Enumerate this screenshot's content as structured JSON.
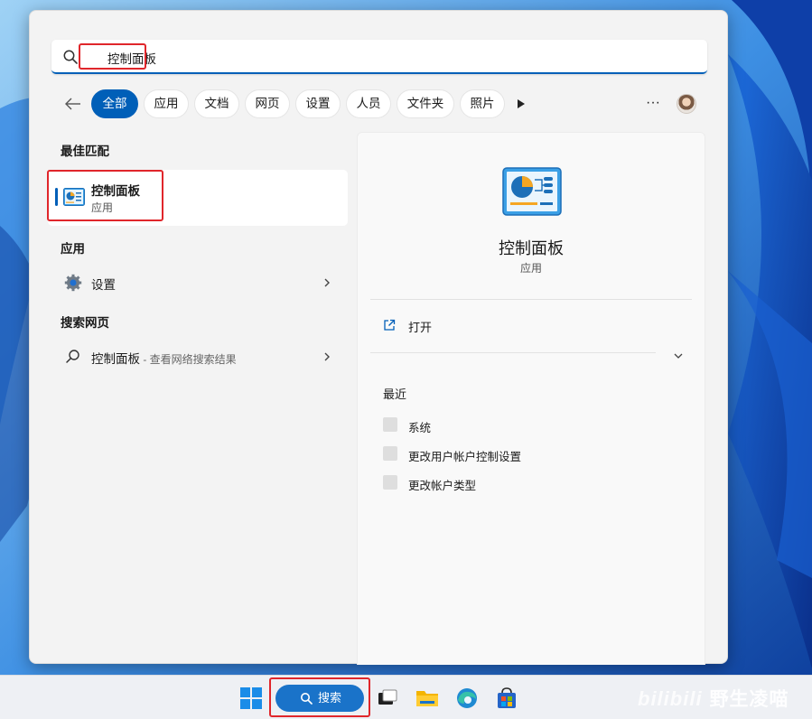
{
  "search": {
    "query": "控制面板"
  },
  "filters": {
    "back_label": "back",
    "chips": [
      "全部",
      "应用",
      "文档",
      "网页",
      "设置",
      "人员",
      "文件夹",
      "照片"
    ],
    "more_label": "···"
  },
  "left": {
    "best_match_title": "最佳匹配",
    "best_match": {
      "name": "控制面板",
      "kind": "应用"
    },
    "apps_title": "应用",
    "apps": [
      {
        "name": "设置"
      }
    ],
    "web_title": "搜索网页",
    "web": [
      {
        "name": "控制面板",
        "sub": " - 查看网络搜索结果"
      }
    ]
  },
  "detail": {
    "title": "控制面板",
    "kind": "应用",
    "open_label": "打开",
    "recent_title": "最近",
    "recent": [
      "系统",
      "更改用户帐户控制设置",
      "更改帐户类型"
    ]
  },
  "taskbar": {
    "search_label": "搜索",
    "watermark_logo": "bilibili",
    "watermark_text": "野生凌喵"
  },
  "colors": {
    "accent": "#005fb8",
    "highlight": "#e0262b",
    "panel": "#f3f3f3"
  },
  "icons": [
    "search-icon",
    "back-arrow-icon",
    "play-icon",
    "more-icon",
    "control-panel-icon",
    "settings-gear-icon",
    "chevron-right-icon",
    "open-external-icon",
    "chevron-down-icon",
    "windows-start-icon",
    "task-view-icon",
    "file-explorer-icon",
    "edge-icon",
    "store-icon"
  ]
}
